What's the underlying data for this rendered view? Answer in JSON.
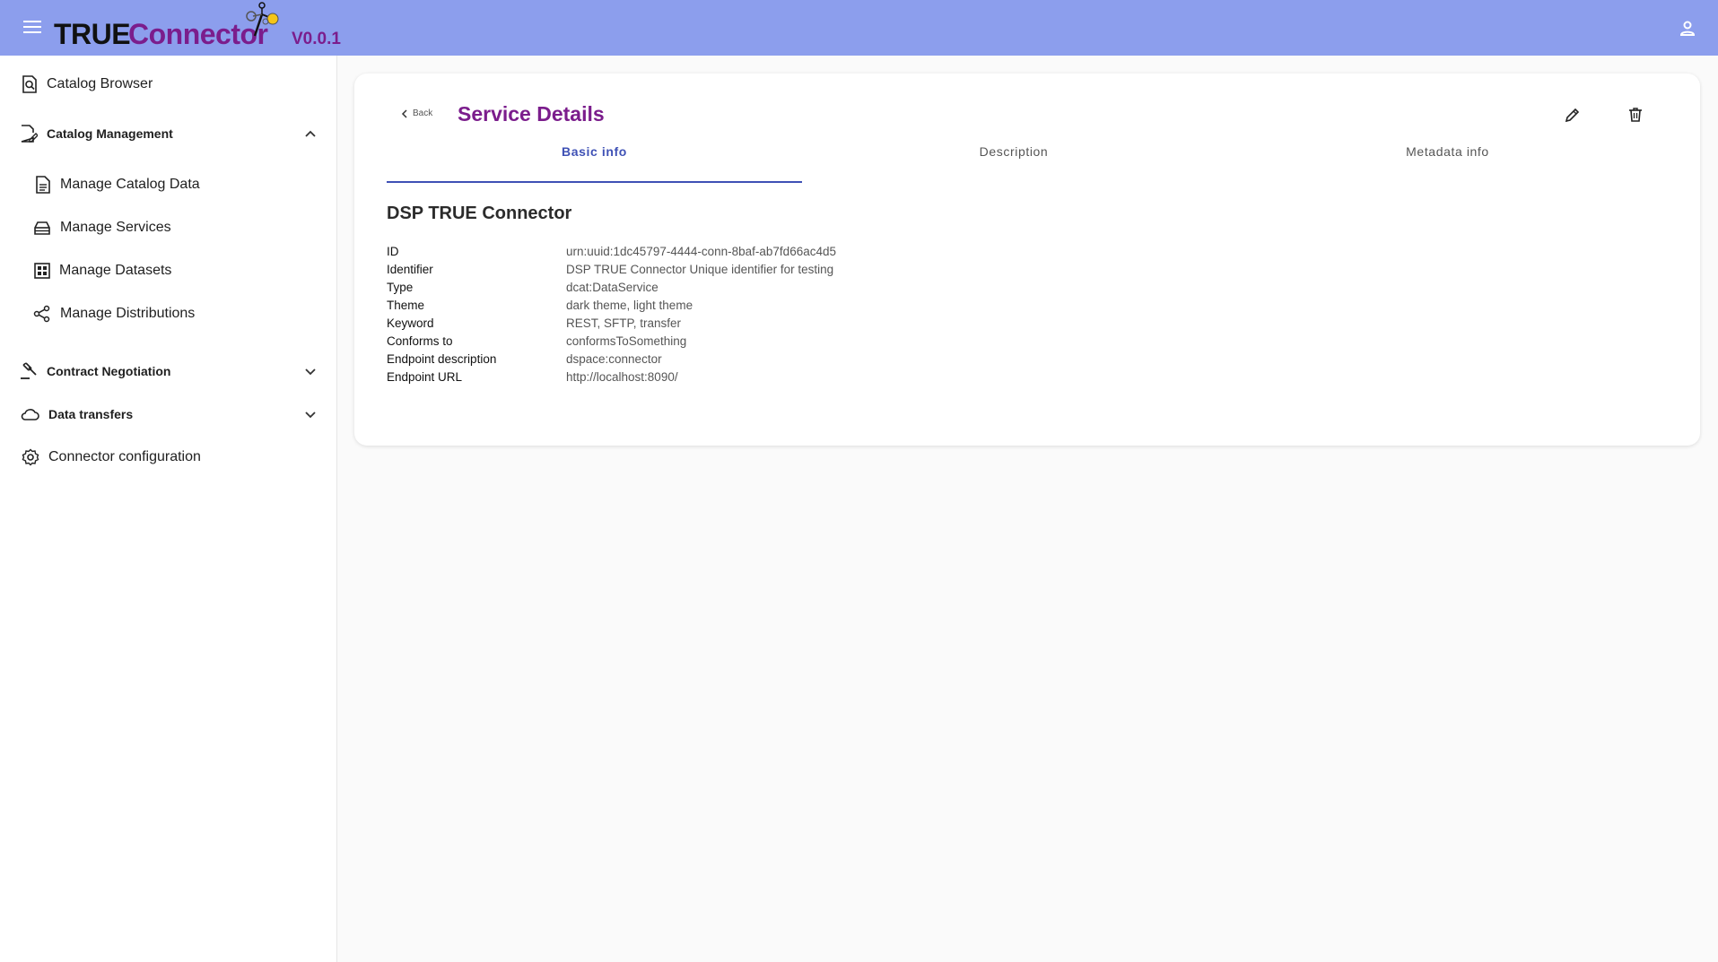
{
  "app": {
    "logo_part1": "TRUE",
    "logo_part2": "Connector",
    "version": "V0.0.1",
    "brand_color": "#7b1d8c",
    "header_color": "#8c9eed"
  },
  "sidebar": {
    "catalog_browser": "Catalog Browser",
    "catalog_management": "Catalog Management",
    "manage_catalog_data": "Manage Catalog Data",
    "manage_services": "Manage Services",
    "manage_datasets": "Manage Datasets",
    "manage_distributions": "Manage Distributions",
    "contract_negotiation": "Contract Negotiation",
    "data_transfers": "Data transfers",
    "connector_configuration": "Connector configuration"
  },
  "page": {
    "back_label": "Back",
    "title": "Service Details",
    "tabs": [
      "Basic info",
      "Description",
      "Metadata info"
    ],
    "active_tab": "Basic info",
    "section_title": "DSP TRUE Connector",
    "details": [
      {
        "label": "ID",
        "value": "urn:uuid:1dc45797-4444-conn-8baf-ab7fd66ac4d5"
      },
      {
        "label": "Identifier",
        "value": "DSP TRUE Connector Unique identifier for testing"
      },
      {
        "label": "Type",
        "value": "dcat:DataService"
      },
      {
        "label": "Theme",
        "value": "dark theme, light theme"
      },
      {
        "label": "Keyword",
        "value": "REST, SFTP, transfer"
      },
      {
        "label": "Conforms to",
        "value": "conformsToSomething"
      },
      {
        "label": "Endpoint description",
        "value": "dspace:connector"
      },
      {
        "label": "Endpoint URL",
        "value": "http://localhost:8090/"
      }
    ],
    "accent_color": "#3f51b5"
  }
}
